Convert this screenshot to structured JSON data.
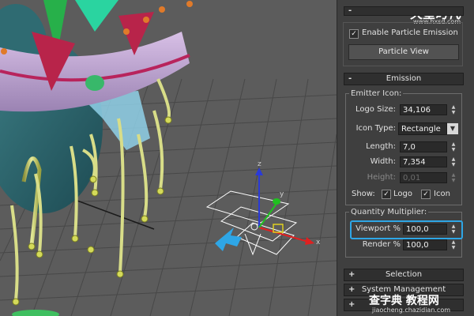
{
  "colors": {
    "viewport_bg": "#5a5a5a",
    "panel_bg": "#3f3f3f",
    "highlight": "#2ea6e6",
    "arrow": "#2ea6e6"
  },
  "watermark": {
    "logo_text": "火星时代",
    "logo_url": "www.hxsd.com",
    "bottom_text": "查字典 教程网",
    "bottom_url": "jiaocheng.chazidian.com"
  },
  "top_rollout": {
    "pm": "-",
    "enable_particle_emission_label": "Enable Particle Emission",
    "enable_particle_emission_checked": "✓",
    "particle_view_button": "Particle View"
  },
  "emission": {
    "pm": "-",
    "title": "Emission",
    "emitter_icon_group": "Emitter Icon:",
    "logo_size_label": "Logo Size:",
    "logo_size_value": "34,106",
    "icon_type_label": "Icon Type:",
    "icon_type_value": "Rectangle",
    "length_label": "Length:",
    "length_value": "7,0",
    "width_label": "Width:",
    "width_value": "7,354",
    "height_label": "Height:",
    "height_value": "0,01",
    "show_label": "Show:",
    "show_logo_label": "Logo",
    "show_logo_checked": "✓",
    "show_icon_label": "Icon",
    "show_icon_checked": "✓",
    "quantity_group": "Quantity Multiplier:",
    "viewport_label": "Viewport %",
    "viewport_value": "100,0",
    "render_label": "Render %",
    "render_value": "100,0"
  },
  "selection_rollout": {
    "pm": "+",
    "title": "Selection"
  },
  "system_management_rollout": {
    "pm": "+",
    "title": "System Management"
  },
  "script_rollout": {
    "pm": "+",
    "title": ""
  }
}
